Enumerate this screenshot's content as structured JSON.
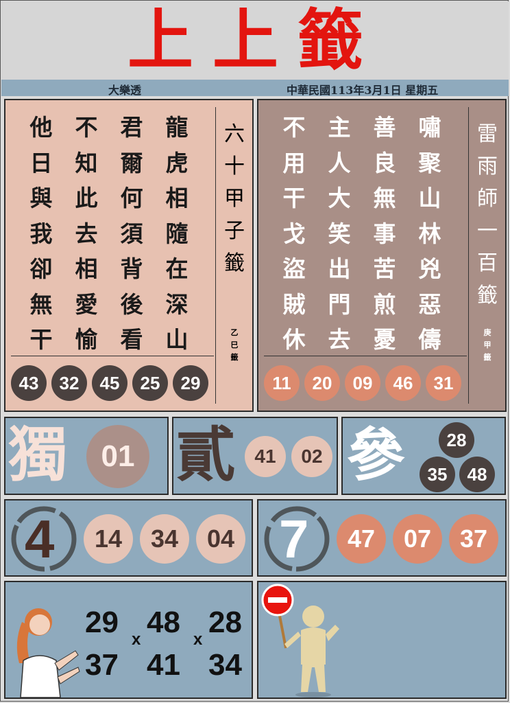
{
  "title": "上上籤",
  "info": {
    "left": "大樂透",
    "right": "中華民國113年3月1日 星期五"
  },
  "left_card": {
    "columns": [
      [
        "龍",
        "虎",
        "相",
        "隨",
        "在",
        "深",
        "山"
      ],
      [
        "君",
        "爾",
        "何",
        "須",
        "背",
        "後",
        "看"
      ],
      [
        "不",
        "知",
        "此",
        "去",
        "相",
        "愛",
        "愉"
      ],
      [
        "他",
        "日",
        "與",
        "我",
        "卻",
        "無",
        "干"
      ]
    ],
    "side_title": [
      "六",
      "十",
      "甲",
      "子",
      "籤"
    ],
    "side_small": [
      "乙",
      "巳",
      "籤"
    ],
    "numbers": [
      "43",
      "32",
      "45",
      "25",
      "29"
    ]
  },
  "right_card": {
    "columns": [
      [
        "嘯",
        "聚",
        "山",
        "林",
        "兇",
        "惡",
        "儔"
      ],
      [
        "善",
        "良",
        "無",
        "事",
        "苦",
        "煎",
        "憂"
      ],
      [
        "主",
        "人",
        "大",
        "笑",
        "出",
        "門",
        "去"
      ],
      [
        "不",
        "用",
        "干",
        "戈",
        "盜",
        "賊",
        "休"
      ]
    ],
    "side_title": [
      "雷",
      "雨",
      "師",
      "一",
      "百",
      "籤"
    ],
    "side_small": [
      "庚",
      "甲",
      "籤"
    ],
    "numbers": [
      "11",
      "20",
      "09",
      "46",
      "31"
    ]
  },
  "single": {
    "label": "獨",
    "number": "01"
  },
  "double": {
    "label": "貳",
    "numbers": [
      "41",
      "02"
    ]
  },
  "triple": {
    "label": "參",
    "numbers": [
      "28",
      "35",
      "48"
    ]
  },
  "four": {
    "label": "4",
    "numbers": [
      "14",
      "34",
      "04"
    ]
  },
  "seven": {
    "label": "7",
    "numbers": [
      "47",
      "07",
      "37"
    ]
  },
  "combo": {
    "top": [
      "29",
      "48",
      "28"
    ],
    "bottom": [
      "37",
      "41",
      "34"
    ],
    "sep": "x"
  },
  "colors": {
    "title": "#e3150f",
    "blue": "#8faabd",
    "pink": "#e7c1b1",
    "taupe": "#a98f87",
    "dark_ball": "#4a413f",
    "orange_ball": "#dc8a6e"
  },
  "icons": [
    "woman-pointing-illustration",
    "stop-sign-figure-icon"
  ]
}
